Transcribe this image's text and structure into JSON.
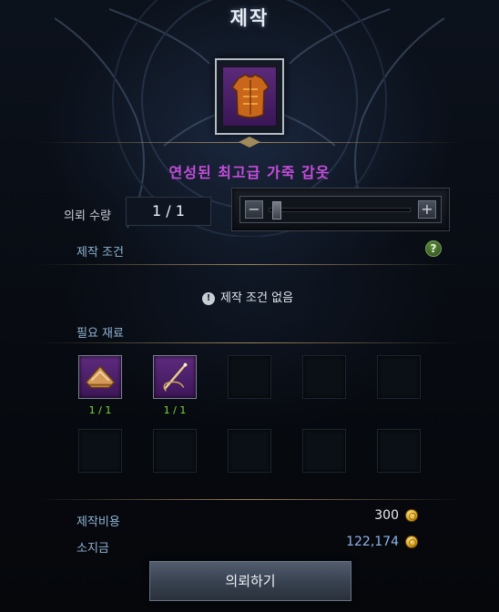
{
  "window": {
    "title": "제작"
  },
  "item": {
    "name": "연성된 최고급 가죽 갑옷",
    "icon": "leather-armor-icon",
    "name_color": "#c44ddb"
  },
  "quantity": {
    "label": "의뢰 수량",
    "value": "1 / 1",
    "minus": "−",
    "plus": "+",
    "slider_fraction": 0.0
  },
  "conditions": {
    "label": "제작 조건",
    "help": "?",
    "status_icon": "!",
    "status": "제작 조건 없음"
  },
  "materials": {
    "label": "필요 재료",
    "slots": [
      {
        "icon": "leather-bundle-icon",
        "count": "1 / 1"
      },
      {
        "icon": "thread-icon",
        "count": "1 / 1"
      },
      {
        "icon": "",
        "count": ""
      },
      {
        "icon": "",
        "count": ""
      },
      {
        "icon": "",
        "count": ""
      },
      {
        "icon": "",
        "count": ""
      },
      {
        "icon": "",
        "count": ""
      },
      {
        "icon": "",
        "count": ""
      },
      {
        "icon": "",
        "count": ""
      },
      {
        "icon": "",
        "count": ""
      }
    ]
  },
  "cost": {
    "label": "제작비용",
    "value": "300",
    "value_color": "#e8ebf0"
  },
  "gold": {
    "label": "소지금",
    "value": "122,174",
    "value_color": "#8fb4e8"
  },
  "action": {
    "label": "의뢰하기"
  }
}
